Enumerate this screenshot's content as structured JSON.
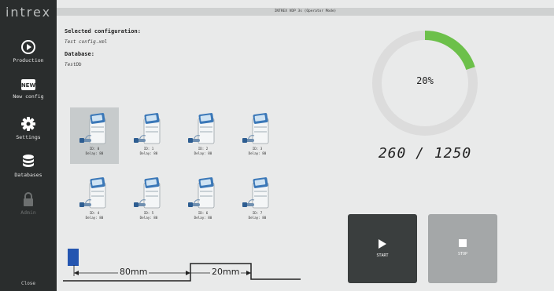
{
  "app": {
    "logo": "intrex",
    "title": "INTREX VDP 3s (Operator Mode)"
  },
  "sidebar": {
    "items": [
      {
        "label": "Production",
        "icon": "play-circle-icon"
      },
      {
        "label": "New config",
        "icon": "new-badge-icon",
        "badge": "NEW"
      },
      {
        "label": "Settings",
        "icon": "gear-icon"
      },
      {
        "label": "Databases",
        "icon": "database-icon"
      },
      {
        "label": "Admin",
        "icon": "lock-icon",
        "disabled": true
      }
    ],
    "close_label": "Close"
  },
  "config": {
    "selected_heading": "Selected configuration:",
    "selected_value": "Test config.xml",
    "database_heading": "Database:",
    "database_value": "TestDb"
  },
  "printers": [
    {
      "id": "ID: 0",
      "delay": "Delay: 80"
    },
    {
      "id": "ID: 1",
      "delay": "Delay: 80"
    },
    {
      "id": "ID: 2",
      "delay": "Delay: 80"
    },
    {
      "id": "ID: 3",
      "delay": "Delay: 80"
    },
    {
      "id": "ID: 4",
      "delay": "Delay: 80"
    },
    {
      "id": "ID: 5",
      "delay": "Delay: 80"
    },
    {
      "id": "ID: 6",
      "delay": "Delay: 80"
    },
    {
      "id": "ID: 7",
      "delay": "Delay: 80"
    }
  ],
  "progress": {
    "percent_text": "20%",
    "fraction": 0.2,
    "count_text": "260 / 1250",
    "color": "#6cc04a"
  },
  "buttons": {
    "start": "START",
    "stop": "STOP"
  },
  "diagram": {
    "dist1": "80mm",
    "dist2": "20mm",
    "marker_color": "#2455b0"
  }
}
